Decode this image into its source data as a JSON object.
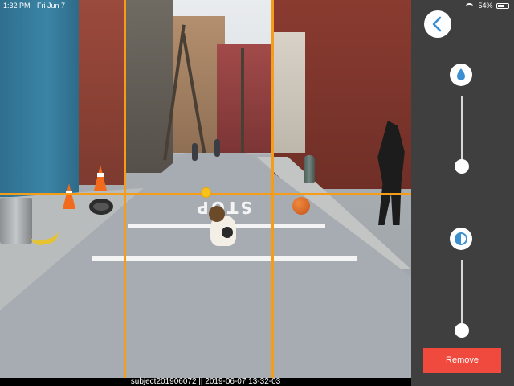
{
  "status_bar": {
    "time": "1:32 PM",
    "date": "Fri Jun 7",
    "battery": "54%",
    "wifi_icon": "wifi-icon",
    "battery_icon": "battery-icon"
  },
  "scene": {
    "street_marking": "STOP"
  },
  "caption": "subject201906072 || 2019-06-07 13-32-03",
  "panel": {
    "back_icon": "chevron-left-icon",
    "brightness_icon": "water-drop-icon",
    "contrast_icon": "contrast-icon",
    "remove_label": "Remove",
    "accent_color": "#3b8fd0",
    "remove_color": "#f04a3e",
    "guide_color": "#f59c18"
  }
}
